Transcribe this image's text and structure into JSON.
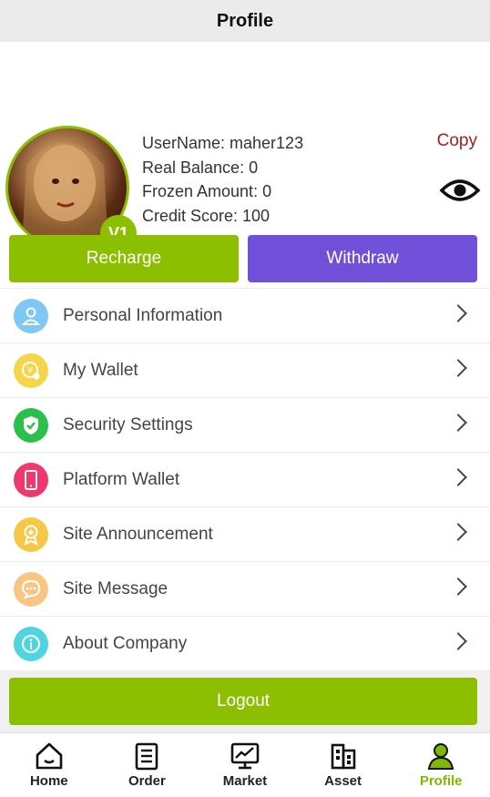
{
  "header": {
    "title": "Profile"
  },
  "profile": {
    "level_badge": "V1",
    "username_line": "UserName: maher123",
    "real_balance_line": "Real Balance: 0",
    "frozen_amount_line": "Frozen Amount: 0",
    "credit_score_line": "Credit Score: 100",
    "copy_label": "Copy"
  },
  "actions": {
    "recharge": "Recharge",
    "withdraw": "Withdraw"
  },
  "menu": [
    {
      "label": "Personal Information",
      "icon": "person-icon",
      "color": "#7ec8f4"
    },
    {
      "label": "My Wallet",
      "icon": "wallet-icon",
      "color": "#f5d54a"
    },
    {
      "label": "Security Settings",
      "icon": "shield-icon",
      "color": "#2bc04b"
    },
    {
      "label": "Platform Wallet",
      "icon": "phone-icon",
      "color": "#f0386e"
    },
    {
      "label": "Site Announcement",
      "icon": "medal-icon",
      "color": "#f7c848"
    },
    {
      "label": "Site Message",
      "icon": "chat-icon",
      "color": "#f8c583"
    },
    {
      "label": "About Company",
      "icon": "info-icon",
      "color": "#4ed6e0"
    }
  ],
  "logout_label": "Logout",
  "tabs": [
    {
      "label": "Home",
      "icon": "home-icon"
    },
    {
      "label": "Order",
      "icon": "order-icon"
    },
    {
      "label": "Market",
      "icon": "market-icon"
    },
    {
      "label": "Asset",
      "icon": "asset-icon"
    },
    {
      "label": "Profile",
      "icon": "profile-icon",
      "active": true
    }
  ],
  "colors": {
    "accent": "#8bbf00",
    "withdraw": "#7050d8",
    "copy": "#a02020"
  }
}
